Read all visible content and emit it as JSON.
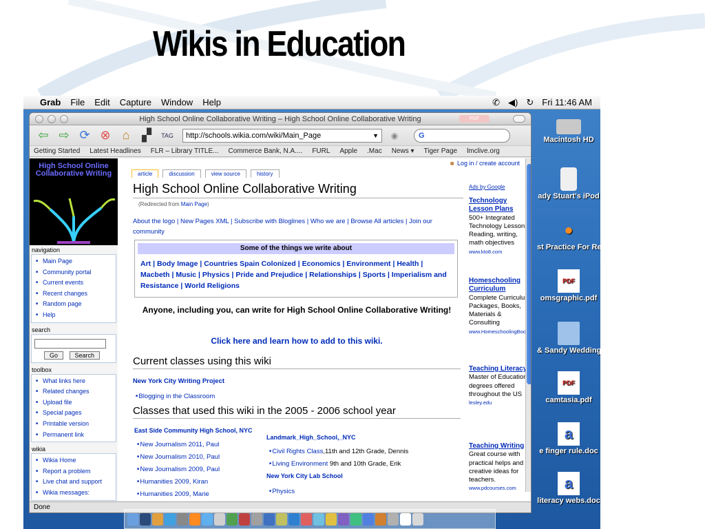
{
  "slide": {
    "title": "Wikis in Education"
  },
  "menubar": {
    "app": "Grab",
    "items": [
      "File",
      "Edit",
      "Capture",
      "Window",
      "Help"
    ],
    "clock": "Fri 11:46 AM"
  },
  "browser": {
    "window_title": "High School Online Collaborative Writing – High School Online Collaborative Writing",
    "url": "http://schools.wikia.com/wiki/Main_Page",
    "search_value": "G",
    "bookmarks": [
      "Getting Started",
      "Latest Headlines",
      "FLR – Library TITLE...",
      "Commerce Bank, N.A....",
      "FURL",
      "Apple",
      ".Mac",
      "News ▾",
      "Tiger Page",
      "lmclive.org"
    ],
    "status": "Done"
  },
  "wiki": {
    "logo_text": "High School Online Collaborative Writing",
    "login": "Log in / create account",
    "tabs": [
      "article",
      "discussion",
      "view source",
      "history"
    ],
    "page_title": "High School Online Collaborative Writing",
    "redirect_prefix": "(Redirected from ",
    "redirect_link": "Main Page",
    "redirect_suffix": ")",
    "about_line": "About the logo | New Pages XML | Subscribe with Bloglines | Who we are | Browse All articles | Join our community",
    "topics_header": "Some of the things we write about",
    "topics": "Art | Body Image | Countries Spain Colonized | Economics | Environment | Health | Macbeth | Music | Physics | Pride and Prejudice | Relationships | Sports | Imperialism and Resistance | World Religions",
    "anyone": "Anyone, including you, can write for High School Online Collaborative Writing!",
    "click_here": "Click here and learn how to add to this wiki.",
    "current_heading": "Current classes using this wiki",
    "nyc_project": "New York City Writing Project",
    "blogging": "Blogging in the Classroom",
    "past_heading": "Classes that used this wiki in the 2005 - 2006 school year",
    "eastside": "East Side Community High School, NYC",
    "eastside_items": [
      "New Journalism 2011, Paul",
      "New Journalism 2010, Paul",
      "New Journalism 2009, Paul",
      "Humanities 2009, Kiran",
      "Humanities 2009, Marie"
    ],
    "landmark": "Landmark_High_School,_NYC",
    "landmark_items": [
      {
        "link": "Civil Rights Class",
        "text": ",11th and 12th Grade, Dennis"
      },
      {
        "link": "Living Environment",
        "text": " 9th and 10th Grade, Erik"
      }
    ],
    "labschool": "New York City Lab School",
    "labschool_item": "Physics"
  },
  "sidebar": {
    "navigation_title": "navigation",
    "navigation": [
      "Main Page",
      "Community portal",
      "Current events",
      "Recent changes",
      "Random page",
      "Help"
    ],
    "search_title": "search",
    "go": "Go",
    "search": "Search",
    "toolbox_title": "toolbox",
    "toolbox": [
      "What links here",
      "Related changes",
      "Upload file",
      "Special pages",
      "Printable version",
      "Permanent link"
    ],
    "wikia_title": "wikia",
    "wikia": [
      "Wikia Home",
      "Report a problem",
      "Live chat and support",
      "Wikia messages:"
    ]
  },
  "ads": {
    "ads_by": "Ads by Google",
    "items": [
      {
        "title": "Technology Lesson Plans",
        "body": "500+ Integrated Technology Lessons Reading, writing, math objectives",
        "url": "www.kto8.com"
      },
      {
        "title": "Homeschooling Curriculum",
        "body": "Complete Curriculum Packages, Books, Materials & Consulting",
        "url": "www.HomeschoolingBoo"
      },
      {
        "title": "Teaching Literacy",
        "body": "Master of Education degrees offered throughout the US",
        "url": "lesley.edu"
      },
      {
        "title": "Teaching Writing",
        "body": "Great course with practical helps and creative ideas for teachers.",
        "url": "www.pdcourses.com"
      }
    ]
  },
  "desktop_icons": [
    "Macintosh HD",
    "ady Stuart's iPod",
    "st Practice For Research",
    "omsgraphic.pdf",
    "& Sandy Wedding",
    "camtasia.pdf",
    "e finger rule.doc",
    "literacy webs.doc"
  ]
}
